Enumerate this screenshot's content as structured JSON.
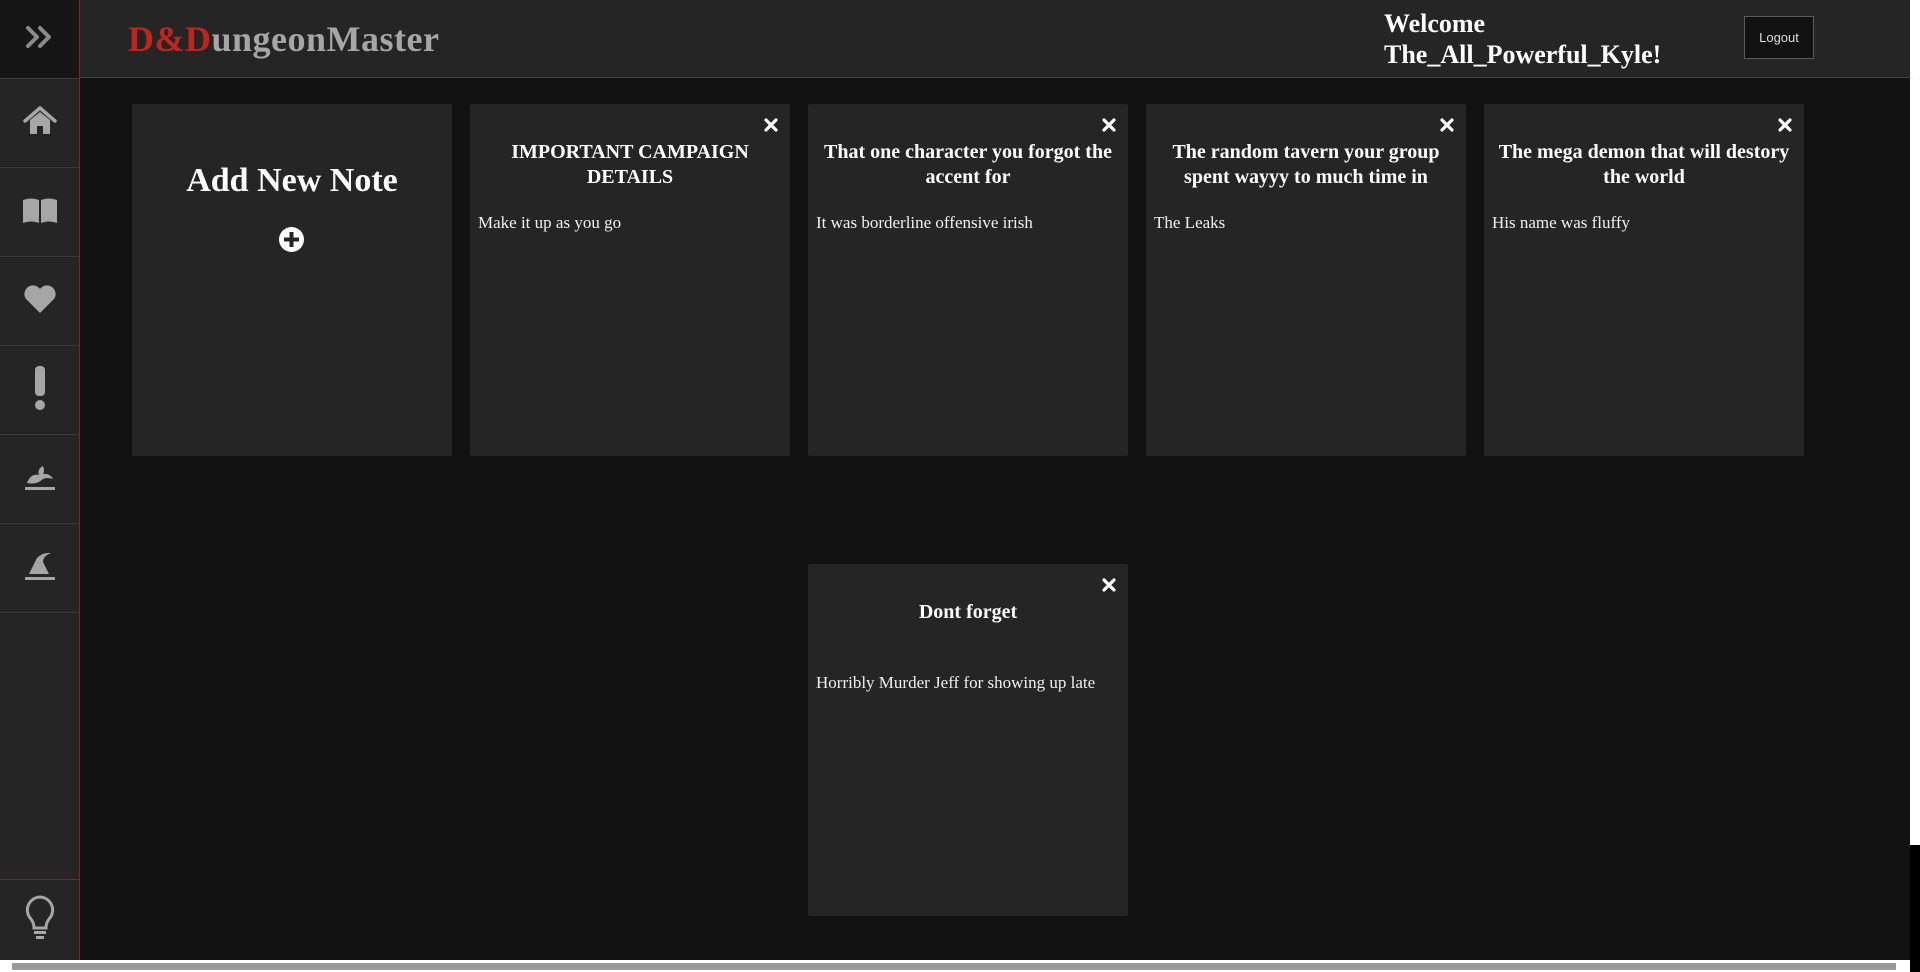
{
  "header": {
    "logo_prefix": "D&D",
    "logo_rest": "ungeonMaster",
    "welcome_line1": "Welcome",
    "welcome_line2": "The_All_Powerful_Kyle!",
    "logout_label": "Logout"
  },
  "sidebar": {
    "toggle_icon": "double-chevron-right-icon",
    "items": [
      {
        "icon": "home-icon"
      },
      {
        "icon": "book-icon"
      },
      {
        "icon": "heart-icon"
      },
      {
        "icon": "exclamation-icon"
      },
      {
        "icon": "dragon-icon"
      },
      {
        "icon": "wizard-hat-icon"
      }
    ],
    "bottom_icon": "lightbulb-icon"
  },
  "add_note": {
    "title": "Add New Note",
    "icon": "plus-circle-icon"
  },
  "notes": [
    {
      "title": "IMPORTANT CAMPAIGN DETAILS",
      "body": "Make it up as you go"
    },
    {
      "title": "That one character you forgot the accent for",
      "body": "It was borderline offensive irish"
    },
    {
      "title": "The random tavern your group spent wayyy to much time in",
      "body": "The Leaks"
    },
    {
      "title": "The mega demon that will destory the world",
      "body": "His name was fluffy"
    },
    {
      "title": "Dont forget",
      "body": "Horribly Murder Jeff for showing up late"
    }
  ],
  "colors": {
    "background": "#121212",
    "panel": "#252525",
    "accent_red": "#c0241f",
    "icon_gray": "#a6a6a6"
  }
}
